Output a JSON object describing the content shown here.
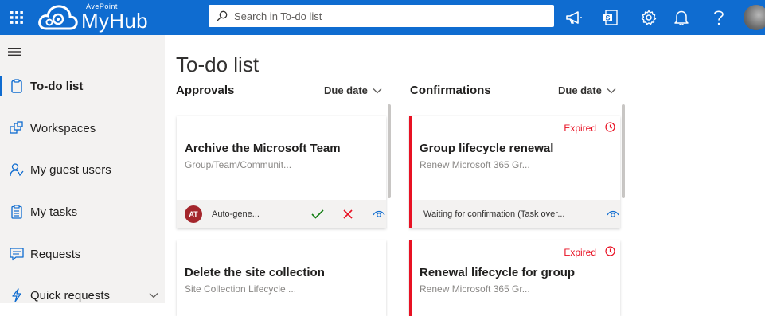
{
  "app": {
    "brand": "AvePoint",
    "name": "MyHub"
  },
  "search": {
    "placeholder": "Search in To-do list"
  },
  "nav": {
    "items": [
      {
        "label": "To-do list",
        "icon": "clipboard-icon",
        "active": true
      },
      {
        "label": "Workspaces",
        "icon": "workspaces-icon"
      },
      {
        "label": "My guest users",
        "icon": "guest-user-icon"
      },
      {
        "label": "My tasks",
        "icon": "tasks-icon"
      },
      {
        "label": "Requests",
        "icon": "chat-icon"
      },
      {
        "label": "Quick requests",
        "icon": "lightning-icon"
      }
    ]
  },
  "page": {
    "title": "To-do list"
  },
  "columns": {
    "approvals": {
      "title": "Approvals",
      "sort": "Due date",
      "cards": [
        {
          "title": "Archive the Microsoft Team",
          "subtitle": "Group/Team/Communit...",
          "avatar": "AT",
          "footer": "Auto-gene..."
        },
        {
          "title": "Delete the site collection",
          "subtitle": "Site Collection Lifecycle ..."
        }
      ]
    },
    "confirmations": {
      "title": "Confirmations",
      "sort": "Due date",
      "cards": [
        {
          "status": "Expired",
          "title": "Group lifecycle renewal",
          "subtitle": "Renew Microsoft 365 Gr...",
          "footer": "Waiting for confirmation (Task over..."
        },
        {
          "status": "Expired",
          "title": "Renewal lifecycle for group",
          "subtitle": "Renew Microsoft 365 Gr..."
        }
      ]
    }
  },
  "colors": {
    "brand": "#0f6cd0",
    "expired": "#e81123",
    "approve": "#107c10",
    "reject": "#e81123",
    "avatar": "#a4262c"
  }
}
